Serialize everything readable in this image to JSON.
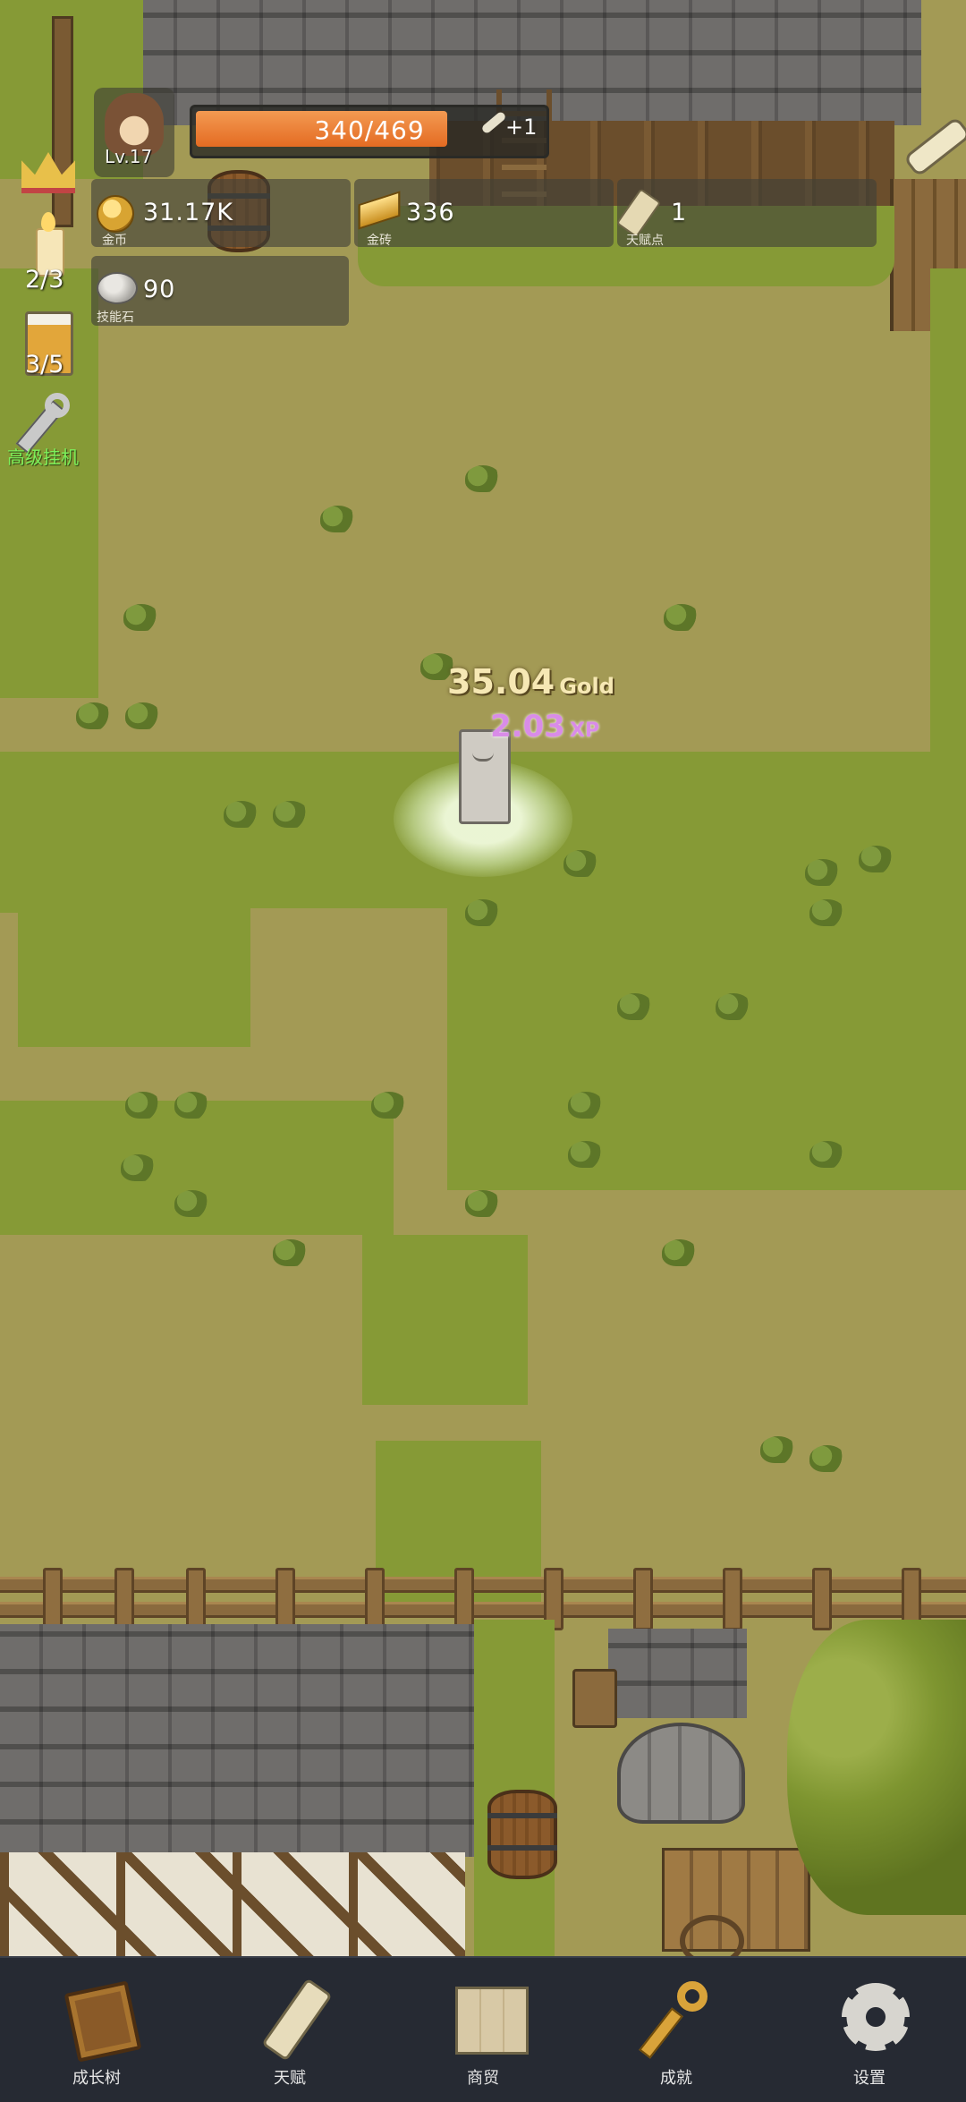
{
  "hud": {
    "player_level": "Lv.17",
    "hp_text": "340/469",
    "hp_fraction": 0.725,
    "bonus_text": "+1"
  },
  "resources": {
    "gold": {
      "value": "31.17K",
      "label": "金币"
    },
    "gold_bar": {
      "value": "336",
      "label": "金砖"
    },
    "talent_points": {
      "value": "1",
      "label": "天赋点"
    },
    "skill_stone": {
      "value": "90",
      "label": "技能石"
    }
  },
  "side": {
    "candle_count": "2/3",
    "beer_count": "3/5",
    "idle_label": "高级挂机"
  },
  "popup": {
    "gold_value": "35.04",
    "gold_unit": "Gold",
    "xp_value": "2.03",
    "xp_unit": "XP"
  },
  "nav": {
    "items": [
      {
        "label": "成长树",
        "icon": "book-icon"
      },
      {
        "label": "天赋",
        "icon": "scroll-icon"
      },
      {
        "label": "商贸",
        "icon": "map-icon"
      },
      {
        "label": "成就",
        "icon": "key-icon"
      },
      {
        "label": "设置",
        "icon": "gear-icon"
      }
    ]
  },
  "colors": {
    "hp_bar": "#ee7a2e",
    "nav_bg": "#262a33",
    "gold_text": "#f6e8b4",
    "xp_text": "#d98ce8",
    "idle_text": "#7cf05a"
  }
}
